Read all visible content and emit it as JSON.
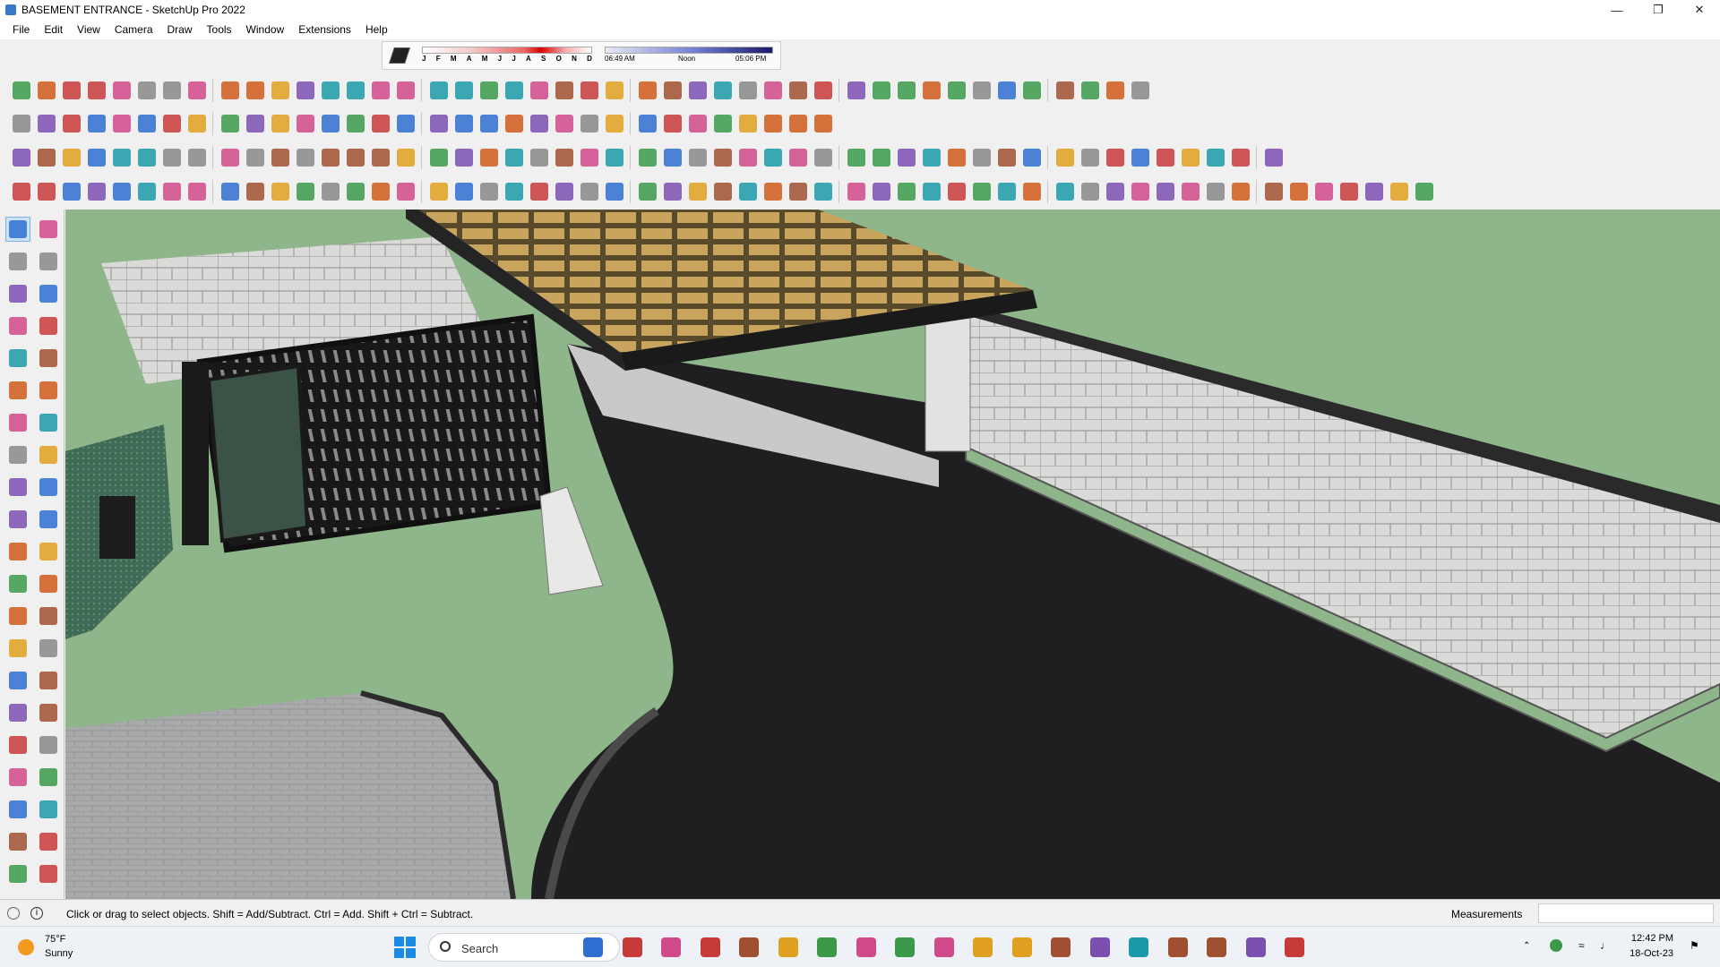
{
  "window": {
    "title": "BASEMENT ENTRANCE - SketchUp Pro 2022",
    "controls": [
      "minimize-icon",
      "restore-icon",
      "close-icon"
    ]
  },
  "menu": [
    "File",
    "Edit",
    "View",
    "Camera",
    "Draw",
    "Tools",
    "Window",
    "Extensions",
    "Help"
  ],
  "shadow_settings": {
    "months": [
      "J",
      "F",
      "M",
      "A",
      "M",
      "J",
      "J",
      "A",
      "S",
      "O",
      "N",
      "D"
    ],
    "time_start": "06:49 AM",
    "time_mid": "Noon",
    "time_end": "05:06 PM"
  },
  "toolbars": {
    "row1_icons": [
      "freehand-curve-icon",
      "bezier-icon",
      "arc-icon",
      "curve-tool-icon",
      "gear-icon",
      "shape-icon",
      "spring-icon",
      "cloud-icon",
      "sphere-icon",
      "arrow-curve-icon",
      "line-icon",
      "line-angle-icon",
      "dim-icon",
      "arch-icon",
      "stair-icon",
      "fence-icon",
      "column-icon",
      "grid-icon",
      "mesh-icon",
      "roof-icon",
      "stair-left-icon",
      "stair-right-icon",
      "ramp-icon",
      "wall-icon",
      "truss-icon",
      "rail-icon",
      "door-icon",
      "window-icon",
      "beam-icon",
      "frame-icon",
      "panel-icon",
      "facade-icon",
      "lattice-icon",
      "brick-icon",
      "wave-icon",
      "fan-icon",
      "joist-icon",
      "louver-icon",
      "rotate-icon",
      "box-icon",
      "house-icon",
      "house-outline-icon",
      "garage-icon",
      "store-icon"
    ],
    "row2_icons": [
      "zoom-icon",
      "select-arrow-icon",
      "eraser-icon",
      "pencil-icon",
      "arc-tool-icon",
      "rectangle-icon",
      "push-pull-icon",
      "follow-me-icon",
      "move-icon",
      "rotate-tool-icon",
      "scale-icon",
      "tape-measure-icon",
      "text-icon",
      "paint-bucket-icon",
      "orbit-icon",
      "pan-icon",
      "zoom-tool-icon",
      "zoom-extents-icon",
      "warehouse-icon",
      "extension-warehouse-icon",
      "layout-icon",
      "sandbox-icon",
      "sketchy-icon",
      "styles-icon",
      "arrow-up-icon",
      "arrow-down-icon",
      "arrow-red-icon",
      "arrow-green-icon",
      "arrow-orange-icon",
      "arrow-multi-icon",
      "arrow-magenta-icon",
      "magic-icon"
    ],
    "row3_icons": [
      "views-iso-icon",
      "views-top-icon",
      "views-front-icon",
      "x-ray-icon",
      "back-edges-icon",
      "wireframe-icon",
      "hidden-line-icon",
      "shaded-icon",
      "textured-icon",
      "monochrome-icon",
      "section-plane-icon",
      "section-fill-icon",
      "brush-icon",
      "ruler-icon",
      "ring-icon",
      "ring2-icon",
      "ring3-icon",
      "ring4-icon",
      "ring5-icon",
      "ring6-icon",
      "ring7-icon",
      "ring8-icon",
      "ring9-icon",
      "measure-red-icon",
      "eraser-pink-icon",
      "panel-blue-icon",
      "panel-blue2-icon",
      "panel-blue3-icon",
      "terrain-icon",
      "tree-icon",
      "swirl-icon",
      "swirl2-icon",
      "pot-icon",
      "pot2-icon",
      "pot3-icon",
      "spin-icon",
      "align-icon",
      "align2-icon",
      "frame-tool-icon",
      "frame2-icon",
      "frame3-icon",
      "lock-icon",
      "bag-icon",
      "carpet-icon",
      "roof-red-icon",
      "roof-gray-icon",
      "bucket-icon",
      "plane-icon",
      "plane2-icon"
    ],
    "row4_icons": [
      "pivot-icon",
      "funnel-icon",
      "circle-orange-icon",
      "protractor-icon",
      "axes-icon",
      "sun-icon",
      "dome-icon",
      "sphere2-icon",
      "solid-union-icon",
      "solid-subtract-icon",
      "scale-box-icon",
      "solid-box-icon",
      "solid-box2-icon",
      "cube-mesh-icon",
      "sphere-mesh-icon",
      "hand-icon",
      "cube-blue-icon",
      "diamond-blue-icon",
      "diamond-yellow-icon",
      "diamond-green-icon",
      "diamond-red-icon",
      "diamond-white-icon",
      "hook-icon",
      "square-red-icon",
      "lines-red-icon",
      "curtain-icon",
      "box-brown-icon",
      "pipe-icon",
      "curve-line-icon",
      "points-icon",
      "cross-red-icon",
      "cross-green-icon",
      "cross-blue-icon",
      "cone-teal-icon",
      "cone-multi-icon",
      "cone-yellow-icon",
      "hook-yellow-icon",
      "hook-multi-icon",
      "loop-icon",
      "star-blue-icon",
      "barrel-icon",
      "u-turn-icon",
      "pyramid-green-icon",
      "shape-multi-icon",
      "box-stack-icon",
      "dice-icon",
      "chest-icon",
      "sun-yellow-icon",
      "frame-yellow-icon",
      "grid-orange-icon",
      "grid-orange2-icon",
      "grid-orange3-icon",
      "scatter-red-icon",
      "curve-dots-icon",
      "grid-select-icon"
    ]
  },
  "left_tools": [
    "select-tool-icon",
    "orbit-tool-icon",
    "paint-tool-icon",
    "eraser-tool-icon",
    "component-tool-icon",
    "tag-tool-icon",
    "line-tool-icon",
    "freehand-tool-icon",
    "rectangle-tool-icon",
    "rotated-rect-icon",
    "circle-tool-icon",
    "polygon-tool-icon",
    "arc-tool-icon",
    "two-point-arc-icon",
    "pie-tool-icon",
    "three-point-arc-icon",
    "move-tool-icon",
    "push-pull-tool-icon",
    "rotate-tool-icon",
    "follow-me-tool-icon",
    "scale-tool-icon",
    "offset-tool-icon",
    "tape-tool-icon",
    "dimension-tool-icon",
    "protractor-tool-icon",
    "text-tool-icon",
    "axes-tool-icon",
    "3d-text-icon",
    "orbit2-tool-icon",
    "pan-tool-icon",
    "zoom-tool-icon",
    "zoom-window-icon",
    "zoom-extents-tool-icon",
    "previous-view-icon",
    "position-camera-icon",
    "look-around-icon",
    "walk-icon",
    "section-tool-icon",
    "warehouse-tool-icon",
    "extension-tool-icon",
    "layout-tool-icon",
    "sandbox-tool-icon"
  ],
  "status": {
    "hint": "Click or drag to select objects. Shift = Add/Subtract. Ctrl = Add. Shift + Ctrl = Subtract.",
    "measurements_label": "Measurements",
    "measurements_value": ""
  },
  "taskbar": {
    "temp": "75°F",
    "condition": "Sunny",
    "search": "Search",
    "apps": [
      "widgets-icon",
      "copilot-icon",
      "task-view-icon",
      "chat-icon",
      "calculator-icon",
      "file-explorer-icon",
      "opera-icon",
      "telegram-icon",
      "sketchup-icon",
      "sticky-notes-icon",
      "grammarly-icon",
      "vscode-icon",
      "3dsmax-icon",
      "photoshop-icon",
      "autodesk-icon",
      "chrome-icon",
      "pinterest-icon",
      "soundcloud-icon",
      "sketchup-active-icon"
    ],
    "time": "12:42 PM",
    "date": "18-Oct-23"
  },
  "colors": {
    "sky_green": "#8fb58a",
    "road": "#1f1f21",
    "paving": "#a6a8aa",
    "wall_light": "#d8d8d6",
    "wall_dark": "#2a2a2a",
    "glass_warm": "#b89552",
    "accent_blue": "#1a8ae6"
  }
}
